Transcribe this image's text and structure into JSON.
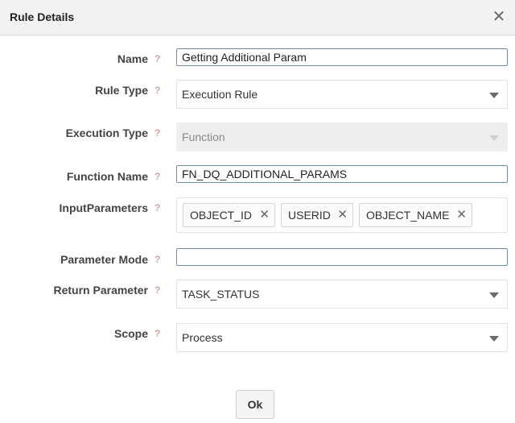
{
  "dialog": {
    "title": "Rule Details",
    "close_icon": "close-icon"
  },
  "help_glyph": "?",
  "fields": {
    "name": {
      "label": "Name",
      "value": "Getting Additional Param"
    },
    "rule_type": {
      "label": "Rule Type",
      "value": "Execution Rule"
    },
    "execution_type": {
      "label": "Execution Type",
      "value": "Function",
      "disabled": true
    },
    "function_name": {
      "label": "Function Name",
      "value": "FN_DQ_ADDITIONAL_PARAMS"
    },
    "input_parameters": {
      "label": "InputParameters",
      "tags": [
        "OBJECT_ID",
        "USERID",
        "OBJECT_NAME"
      ]
    },
    "parameter_mode": {
      "label": "Parameter Mode",
      "value": ""
    },
    "return_parameter": {
      "label": "Return Parameter",
      "value": "TASK_STATUS"
    },
    "scope": {
      "label": "Scope",
      "value": "Process"
    }
  },
  "footer": {
    "ok_label": "Ok"
  },
  "colors": {
    "input_border": "#6d8fb3",
    "help": "#d9a0a0",
    "header_bg": "#f2f2f2"
  }
}
